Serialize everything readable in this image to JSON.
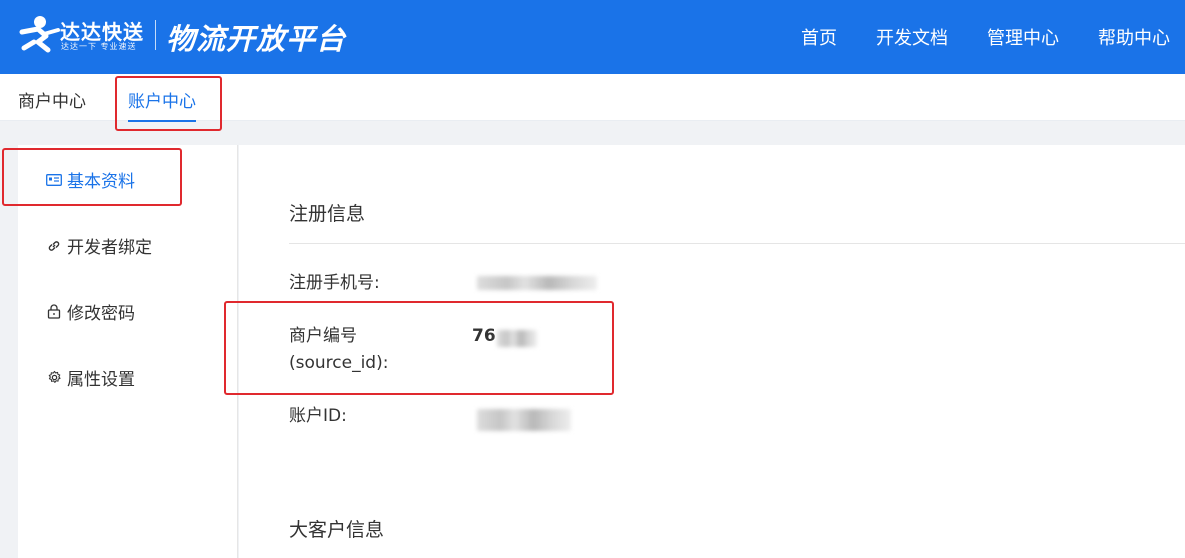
{
  "header": {
    "brand_name": "达达快送",
    "brand_slogan": "达达一下 专业速送",
    "platform_title": "物流开放平台",
    "nav": [
      "首页",
      "开发文档",
      "管理中心",
      "帮助中心"
    ],
    "logo_icon": "dada-runner-logo-icon",
    "bg_color": "#1a73e8"
  },
  "subnav": {
    "tabs": [
      {
        "label": "商户中心",
        "active": false
      },
      {
        "label": "账户中心",
        "active": true
      }
    ],
    "accent_color": "#1a73e8"
  },
  "sidebar": {
    "items": [
      {
        "label": "基本资料",
        "icon": "id-card-icon",
        "active": true
      },
      {
        "label": "开发者绑定",
        "icon": "link-icon",
        "active": false
      },
      {
        "label": "修改密码",
        "icon": "lock-icon",
        "active": false
      },
      {
        "label": "属性设置",
        "icon": "gear-icon",
        "active": false
      }
    ]
  },
  "main": {
    "registration_title": "注册信息",
    "fields": {
      "phone_label": "注册手机号:",
      "merchant_label_line1": "商户编号",
      "merchant_label_line2": "(source_id):",
      "merchant_value_visible": "76",
      "account_id_label": "账户ID:"
    },
    "big_customer_title": "大客户信息"
  },
  "annotations": {
    "highlight_color": "#e0292e"
  }
}
